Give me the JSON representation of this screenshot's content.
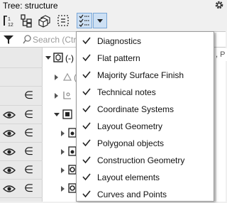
{
  "window": {
    "title": "Tree: structure"
  },
  "toolbar": {
    "buttons": [
      {
        "name": "sort-icon"
      },
      {
        "name": "tree-structure-icon"
      },
      {
        "name": "parts-icon"
      },
      {
        "name": "selection-icon"
      },
      {
        "name": "filter-list-icon"
      },
      {
        "name": "chevron-down-icon"
      }
    ]
  },
  "search": {
    "placeholder": "Search (Ctr"
  },
  "tree": {
    "partial_right_text": ", P",
    "rows": [
      {
        "label": "(-)",
        "partial": "("
      },
      {
        "label": "",
        "partial": "("
      },
      {
        "label": ""
      },
      {
        "label": ""
      },
      {
        "label": ""
      },
      {
        "label": ""
      },
      {
        "label": ""
      },
      {
        "label": ""
      }
    ]
  },
  "menu": {
    "items": [
      {
        "label": "Diagnostics",
        "checked": true
      },
      {
        "label": "Flat pattern",
        "checked": true
      },
      {
        "label": "Majority Surface Finish",
        "checked": true
      },
      {
        "label": "Technical notes",
        "checked": true
      },
      {
        "label": "Coordinate Systems",
        "checked": true
      },
      {
        "label": "Layout Geometry",
        "checked": true
      },
      {
        "label": "Polygonal objects",
        "checked": true
      },
      {
        "label": "Construction Geometry",
        "checked": true
      },
      {
        "label": "Layout elements",
        "checked": true
      },
      {
        "label": "Curves and Points",
        "checked": true
      }
    ]
  },
  "colors": {
    "accent": "#cde0f4",
    "accent_border": "#7aa7d7"
  }
}
